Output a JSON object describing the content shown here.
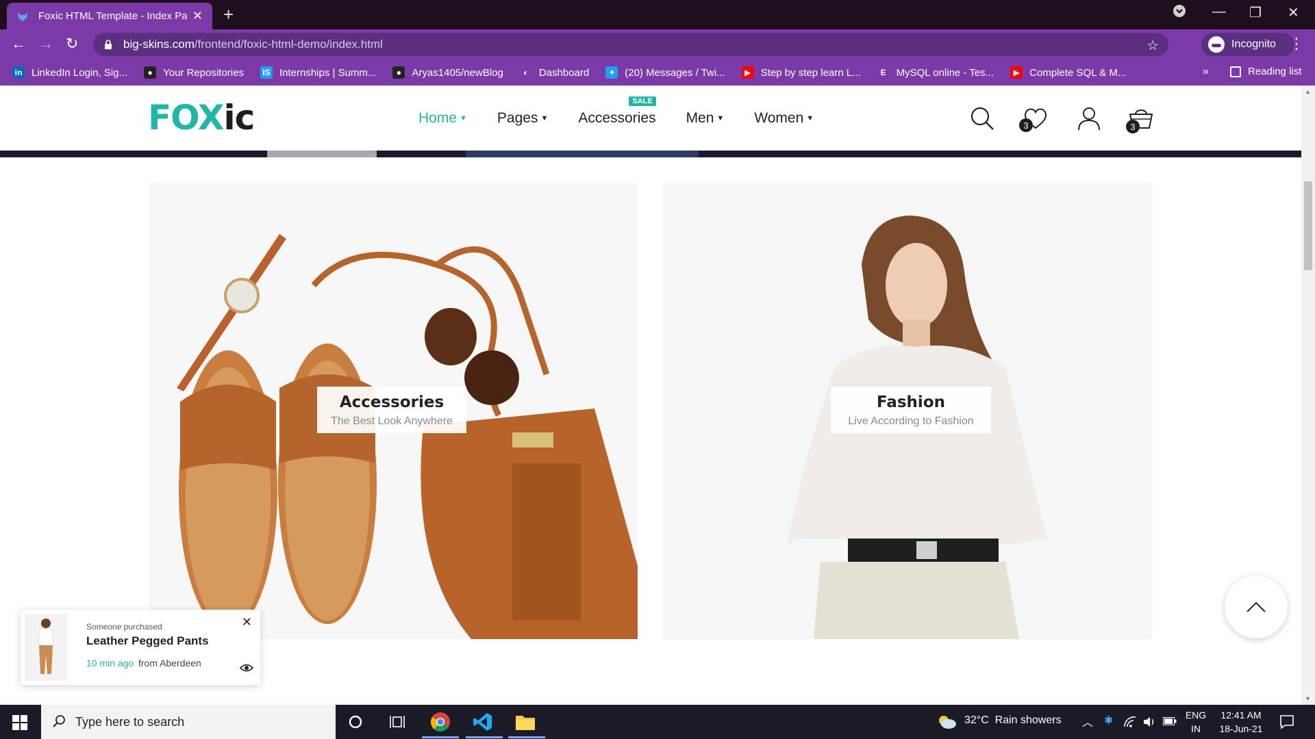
{
  "browser": {
    "tab_title": "Foxic HTML Template - Index Pag",
    "url_host": "big-skins.com",
    "url_path": "/frontend/foxic-html-demo/index.html",
    "incognito_label": "Incognito",
    "accent_color": "#7c3aa8",
    "bookmarks": [
      {
        "label": "LinkedIn Login, Sig...",
        "icon": "linkedin-icon",
        "color": "#0a66c2",
        "glyph": "in"
      },
      {
        "label": "Your Repositories",
        "icon": "github-icon",
        "color": "#222222",
        "glyph": "●"
      },
      {
        "label": "Internships | Summ...",
        "icon": "internshala-icon",
        "color": "#1ea1f2",
        "glyph": "IS"
      },
      {
        "label": "Aryas1405/newBlog",
        "icon": "github-icon",
        "color": "#222222",
        "glyph": "●"
      },
      {
        "label": "Dashboard",
        "icon": "globe-icon",
        "color": "#ffffff",
        "glyph": "◐"
      },
      {
        "label": "(20) Messages / Twi...",
        "icon": "twitter-icon",
        "color": "#1da1f2",
        "glyph": "✦"
      },
      {
        "label": "Step by step learn L...",
        "icon": "youtube-icon",
        "color": "#ff0000",
        "glyph": "▶"
      },
      {
        "label": "MySQL online - Tes...",
        "icon": "e-icon",
        "color": "#ffffff",
        "glyph": "E"
      },
      {
        "label": "Complete SQL & M...",
        "icon": "youtube-icon",
        "color": "#ff0000",
        "glyph": "▶"
      }
    ],
    "reading_list": "Reading list"
  },
  "site": {
    "logo_part1": "FOX",
    "logo_part2": "ic",
    "brand_color": "#20b6a8",
    "menu": [
      {
        "label": "Home",
        "active": true
      },
      {
        "label": "Pages"
      },
      {
        "label": "Accessories",
        "badge": "SALE"
      },
      {
        "label": "Men"
      },
      {
        "label": "Women"
      }
    ],
    "wishlist_count": "3",
    "cart_count": "3"
  },
  "categories": [
    {
      "title": "Accessories",
      "subtitle": "The Best Look Anywhere"
    },
    {
      "title": "Fashion",
      "subtitle": "Live According to Fashion"
    }
  ],
  "purchase_toast": {
    "intro": "Someone purchased",
    "product": "Leather Pegged Pants",
    "time_ago": "10 min ago",
    "from": "from Aberdeen"
  },
  "taskbar": {
    "search_placeholder": "Type here to search",
    "weather": "32°C  Rain showers",
    "lang": "ENG",
    "region": "IN",
    "time": "12:41 AM",
    "date": "18-Jun-21"
  }
}
